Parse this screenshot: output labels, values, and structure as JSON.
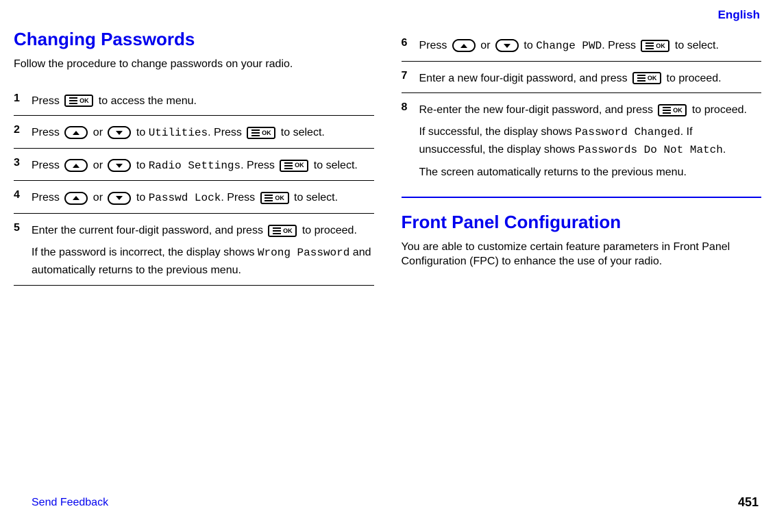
{
  "header": {
    "language": "English"
  },
  "section1": {
    "title": "Changing Passwords",
    "intro": "Follow the procedure to change passwords on your radio.",
    "steps": [
      {
        "num": "1",
        "parts": {
          "p1a": "Press ",
          "p1b": " to access the menu."
        }
      },
      {
        "num": "2",
        "parts": {
          "p1a": "Press ",
          "p1b": " or ",
          "p1c": " to ",
          "mono1": "Utilities",
          "p1d": ". Press ",
          "p1e": " to select."
        }
      },
      {
        "num": "3",
        "parts": {
          "p1a": "Press ",
          "p1b": " or ",
          "p1c": " to ",
          "mono1": "Radio Settings",
          "p1d": ". Press ",
          "p1e": " to select."
        }
      },
      {
        "num": "4",
        "parts": {
          "p1a": "Press ",
          "p1b": " or ",
          "p1c": " to ",
          "mono1": "Passwd Lock",
          "p1d": ". Press ",
          "p1e": " to select."
        }
      },
      {
        "num": "5",
        "parts": {
          "p1a": "Enter the current four-digit password, and press ",
          "p1b": " to proceed.",
          "p2a": "If the password is incorrect, the display shows ",
          "mono2": "Wrong Password",
          "p2b": " and automatically returns to the previous menu."
        }
      },
      {
        "num": "6",
        "parts": {
          "p1a": "Press ",
          "p1b": " or ",
          "p1c": " to ",
          "mono1": "Change PWD",
          "p1d": ". Press ",
          "p1e": " to select."
        }
      },
      {
        "num": "7",
        "parts": {
          "p1a": "Enter a new four-digit password, and press ",
          "p1b": " to proceed."
        }
      },
      {
        "num": "8",
        "parts": {
          "p1a": "Re-enter the new four-digit password, and press ",
          "p1b": " to proceed.",
          "p2a": "If successful, the display shows ",
          "mono2": "Password Changed",
          "p2b": ". If unsuccessful, the display shows ",
          "mono3": "Passwords Do Not Match",
          "p2c": ".",
          "p3": "The screen automatically returns to the previous menu."
        }
      }
    ]
  },
  "section2": {
    "title": "Front Panel Configuration",
    "intro": "You are able to customize certain feature parameters in Front Panel Configuration (FPC) to enhance the use of your radio."
  },
  "footer": {
    "feedback": "Send Feedback",
    "page": "451"
  }
}
